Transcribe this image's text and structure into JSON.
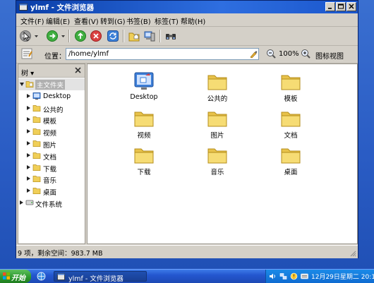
{
  "window": {
    "title": "ylmf - 文件浏览器"
  },
  "menu": [
    "文件(F)",
    "编辑(E)",
    "查看(V)",
    "转到(G)",
    "书签(B)",
    "标签(T)",
    "帮助(H)"
  ],
  "toolbar": {
    "icons": [
      "back-icon",
      "forward-icon",
      "up-icon",
      "stop-icon",
      "reload-icon",
      "home-icon",
      "computer-icon",
      "search-icon"
    ]
  },
  "location": {
    "label": "位置：",
    "path": "/home/ylmf",
    "zoom": "100%",
    "view": "图标视图"
  },
  "sidebar": {
    "title": "树",
    "items": [
      {
        "label": "主文件夹",
        "icon": "home-folder-icon",
        "expanded": true,
        "selected": true
      },
      {
        "label": "Desktop",
        "icon": "desktop-icon"
      },
      {
        "label": "公共的",
        "icon": "folder-icon"
      },
      {
        "label": "模板",
        "icon": "folder-icon"
      },
      {
        "label": "视频",
        "icon": "folder-icon"
      },
      {
        "label": "图片",
        "icon": "folder-icon"
      },
      {
        "label": "文档",
        "icon": "folder-icon"
      },
      {
        "label": "下载",
        "icon": "folder-icon"
      },
      {
        "label": "音乐",
        "icon": "folder-icon"
      },
      {
        "label": "桌面",
        "icon": "folder-icon"
      },
      {
        "label": "文件系统",
        "icon": "drive-icon"
      }
    ]
  },
  "files": [
    {
      "label": "Desktop",
      "icon": "desktop-icon"
    },
    {
      "label": "公共的",
      "icon": "folder-icon"
    },
    {
      "label": "模板",
      "icon": "folder-icon"
    },
    {
      "label": "视频",
      "icon": "folder-icon"
    },
    {
      "label": "图片",
      "icon": "folder-icon"
    },
    {
      "label": "文档",
      "icon": "folder-icon"
    },
    {
      "label": "下载",
      "icon": "folder-icon"
    },
    {
      "label": "音乐",
      "icon": "folder-icon"
    },
    {
      "label": "桌面",
      "icon": "folder-icon"
    }
  ],
  "status": "9 项，剩余空间：983.7 MB",
  "taskbar": {
    "start": "开始",
    "task": "ylmf - 文件浏览器",
    "clock": "12月29日星期二 20:1"
  },
  "colors": {
    "title_bar": "#0a3ea8",
    "desktop": "#2a5cc4",
    "taskbar": "#2457cf",
    "start": "#2f9a2f",
    "folder": "#f3d45a",
    "tray": "#0f6bd1"
  }
}
